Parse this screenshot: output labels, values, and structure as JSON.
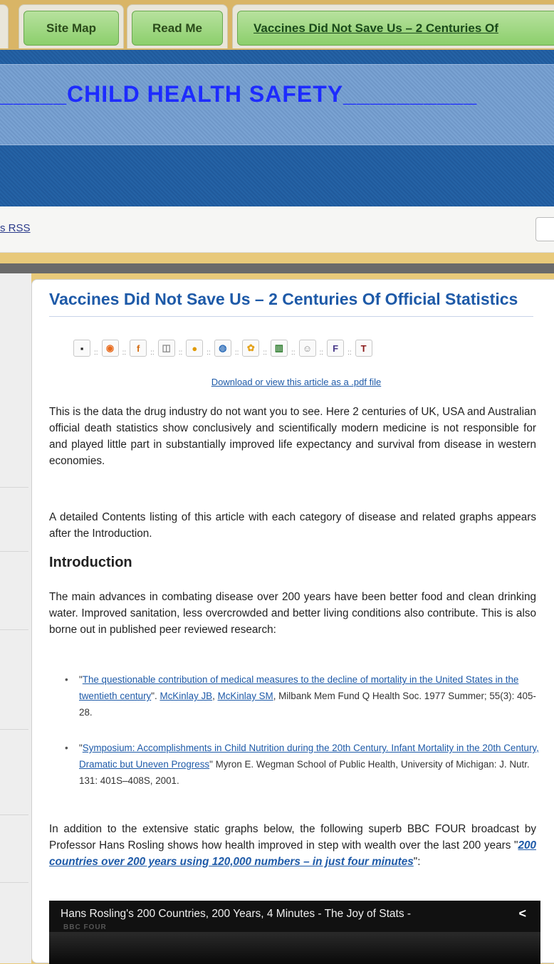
{
  "tabs": [
    {
      "label": "Site Map"
    },
    {
      "label": "Read Me"
    },
    {
      "label": "Vaccines Did Not Save Us – 2 Centuries Of"
    }
  ],
  "header": {
    "site_title": "_____CHILD HEALTH SAFETY__________"
  },
  "rssbar": {
    "rss_text": "s RSS"
  },
  "article": {
    "title": "Vaccines Did Not Save Us – 2 Centuries Of Official Statistics",
    "share_icons": [
      "delicious-icon",
      "stumbleupon-icon",
      "facebook-icon",
      "myspace-icon",
      "yahoo-icon",
      "diigo-icon",
      "mixx-icon",
      "evernote-icon",
      "reddit-icon",
      "fark-icon",
      "technorati-icon"
    ],
    "share_glyphs": [
      "▪",
      "◉",
      "f",
      "◫",
      "●",
      "◍",
      "✿",
      "▥",
      "☺",
      "F",
      "T"
    ],
    "pdf_link": "Download or view this article as a .pdf file",
    "intro_para": "This is the data the drug industry do not want you to see. Here 2 centuries of UK, USA and Australian official death statistics show conclusively and scientifically modern medicine is not responsible for and played little part in substantially improved life expectancy and survival from disease in western economies.",
    "contents_para": "A detailed Contents listing of this article with each category of disease and related graphs appears after the Introduction.",
    "intro_heading": "Introduction",
    "advances_para": "The main advances in combating disease over 200 years have been better food and clean drinking water.  Improved sanitation, less overcrowded and better living conditions also contribute. This is also borne out in published peer reviewed research:",
    "ref1": {
      "open_quote": "\"",
      "title_link": "The questionable contribution of medical measures to the decline of mortality in the United States in the twentieth century",
      "after_title": "\". ",
      "author1": "McKinlay JB",
      "comma": ", ",
      "author2": "McKinlay SM",
      "citation": ", Milbank Mem Fund Q Health Soc. 1977 Summer; 55(3): 405-28."
    },
    "ref2": {
      "open_quote": "\"",
      "title_link": "Symposium: Accomplishments in Child Nutrition during the 20th Century.  Infant Mortality in the 20th Century, Dramatic but Uneven Progress",
      "citation": "\" Myron E. Wegman School of Public Health, University of Michigan: J. Nutr. 131: 401S–408S, 2001."
    },
    "bbc_para": {
      "text": "In addition to the extensive static graphs below, the following superb BBC FOUR broadcast by Professor Hans Rosling shows how health improved in step with wealth over the last 200 years \"",
      "link": "200 countries over 200 years using 120,000 numbers – in just four minutes",
      "end": "\":"
    },
    "video": {
      "title": "Hans Rosling's 200 Countries, 200 Years, 4 Minutes - The Joy of Stats -",
      "channel_mark": "BBC FOUR"
    }
  }
}
